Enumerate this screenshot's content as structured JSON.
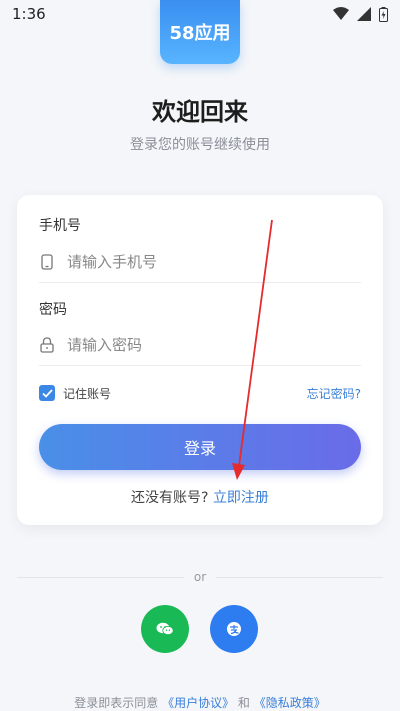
{
  "status_bar": {
    "time": "1:36"
  },
  "app": {
    "logo_text": "58应用"
  },
  "header": {
    "title": "欢迎回来",
    "subtitle": "登录您的账号继续使用"
  },
  "form": {
    "phone_label": "手机号",
    "phone_placeholder": "请输入手机号",
    "password_label": "密码",
    "password_placeholder": "请输入密码",
    "remember_label": "记住账号",
    "remember_checked": true,
    "forgot_label": "忘记密码?",
    "login_label": "登录",
    "no_account_text": "还没有账号?",
    "register_label": "立即注册"
  },
  "divider": {
    "or_text": "or"
  },
  "social": [
    "wechat-icon",
    "alipay-icon"
  ],
  "agreement": {
    "prefix": "登录即表示同意",
    "user_agreement": "《用户协议》",
    "and_text": "和",
    "privacy_policy": "《隐私政策》"
  },
  "colors": {
    "accent": "#3a7fd8",
    "button_start": "#4a8fe8",
    "button_end": "#6a6be8",
    "wechat": "#19b955",
    "alipay": "#2d7cf0",
    "annotation": "#e52b2b"
  }
}
